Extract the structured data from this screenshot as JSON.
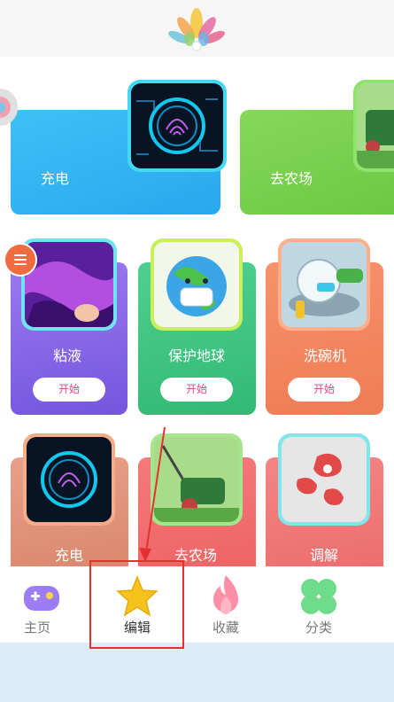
{
  "header": {
    "logo_icon": "lotus-logo-icon"
  },
  "cards": [
    {
      "id": "charge-top",
      "label": "充电",
      "color": "#33b6f4",
      "icon": "fingerprint-icon"
    },
    {
      "id": "farm-top",
      "label": "去农场",
      "color": "#7cd14e",
      "icon": "lawnmower-icon"
    },
    {
      "id": "slime",
      "label": "粘液",
      "color": "#8a6ae6",
      "icon": "slime-icon",
      "button": "开始"
    },
    {
      "id": "earth",
      "label": "保护地球",
      "color": "#3fc784",
      "icon": "earth-mask-icon",
      "button": "开始"
    },
    {
      "id": "dishes",
      "label": "洗碗机",
      "color": "#f5875f",
      "icon": "dishwashing-icon",
      "button": "开始"
    },
    {
      "id": "charge",
      "label": "充电",
      "color": "#e0937a",
      "icon": "fingerprint-icon"
    },
    {
      "id": "farm",
      "label": "去农场",
      "color": "#f26f6f",
      "icon": "lawnmower-icon"
    },
    {
      "id": "tune",
      "label": "调解",
      "color": "#f07a7a",
      "icon": "red-blobs-icon"
    }
  ],
  "tabbar": {
    "tabs": [
      {
        "label": "主页",
        "icon": "gamepad-icon"
      },
      {
        "label": "编辑",
        "icon": "star-icon"
      },
      {
        "label": "收藏",
        "icon": "flame-icon"
      },
      {
        "label": "分类",
        "icon": "clover-icon"
      }
    ],
    "active": "编辑"
  },
  "annotation": {
    "highlight_color": "#e53030"
  }
}
